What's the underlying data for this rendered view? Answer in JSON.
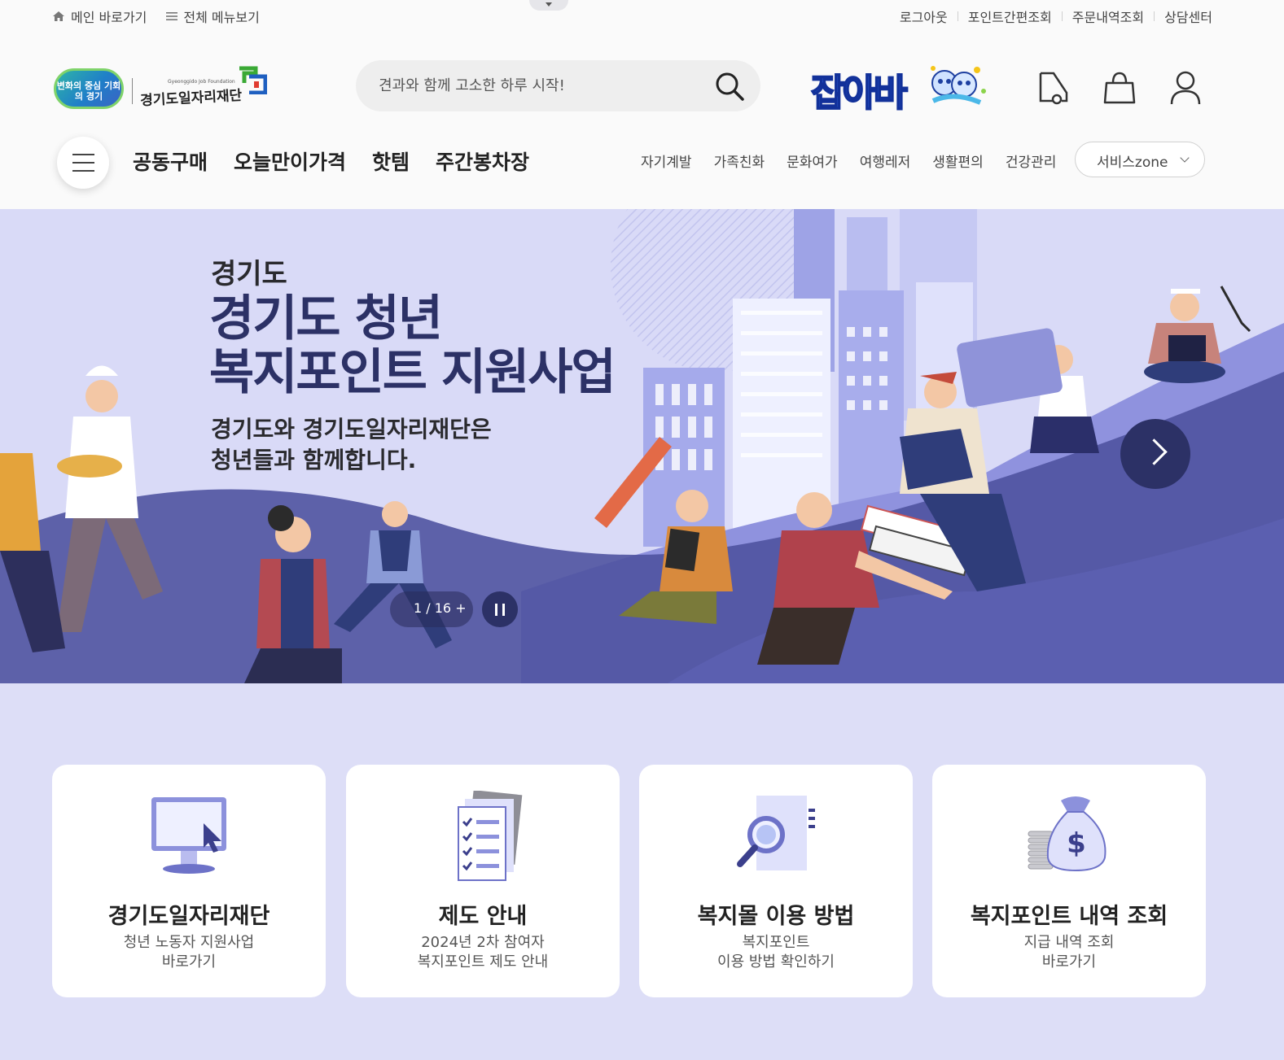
{
  "topbar": {
    "home_link": "메인 바로가기",
    "all_menu_link": "전체 메뉴보기",
    "logout": "로그아웃",
    "point_pay": "포인트간편조회",
    "order_history": "주문내역조회",
    "help_center": "상담센터"
  },
  "header": {
    "logo_oval_text": "변화의 중심 기회의 경기",
    "logo_org": "경기도일자리재단",
    "logo_org_en": "Gyeonggido Job Foundation",
    "search_placeholder": "견과와 함께 고소한 하루 시작!",
    "jobaba_logo": "잡아바"
  },
  "nav": {
    "main": [
      "공동구매",
      "오늘만이가격",
      "핫템",
      "주간봉차장"
    ],
    "sub": [
      "자기계발",
      "가족친화",
      "문화여가",
      "여행레저",
      "생활편의",
      "건강관리"
    ],
    "service_zone": "서비스zone"
  },
  "hero": {
    "subtitle": "경기도",
    "title_line1": "경기도 청년",
    "title_line2": "복지포인트 지원사업",
    "desc_line1": "경기도와 경기도일자리재단은",
    "desc_line2": "청년들과 함께합니다.",
    "counter": "1 / 16 +"
  },
  "cards": [
    {
      "title": "경기도일자리재단",
      "line1": "청년 노동자 지원사업",
      "line2": "바로가기",
      "icon": "monitor-icon"
    },
    {
      "title": "제도 안내",
      "line1": "2024년 2차 참여자",
      "line2": "복지포인트 제도 안내",
      "icon": "document-checklist-icon"
    },
    {
      "title": "복지몰 이용 방법",
      "line1": "복지포인트",
      "line2": "이용 방법 확인하기",
      "icon": "magnifier-document-icon"
    },
    {
      "title": "복지포인트 내역 조회",
      "line1": "지급 내역 조회",
      "line2": "바로가기",
      "icon": "money-bag-icon"
    }
  ],
  "colors": {
    "hero_bg": "#d9daf7",
    "hero_title": "#2c3166",
    "lower_bg": "#dddef7",
    "jobaba_blue": "#2b5fd9"
  }
}
